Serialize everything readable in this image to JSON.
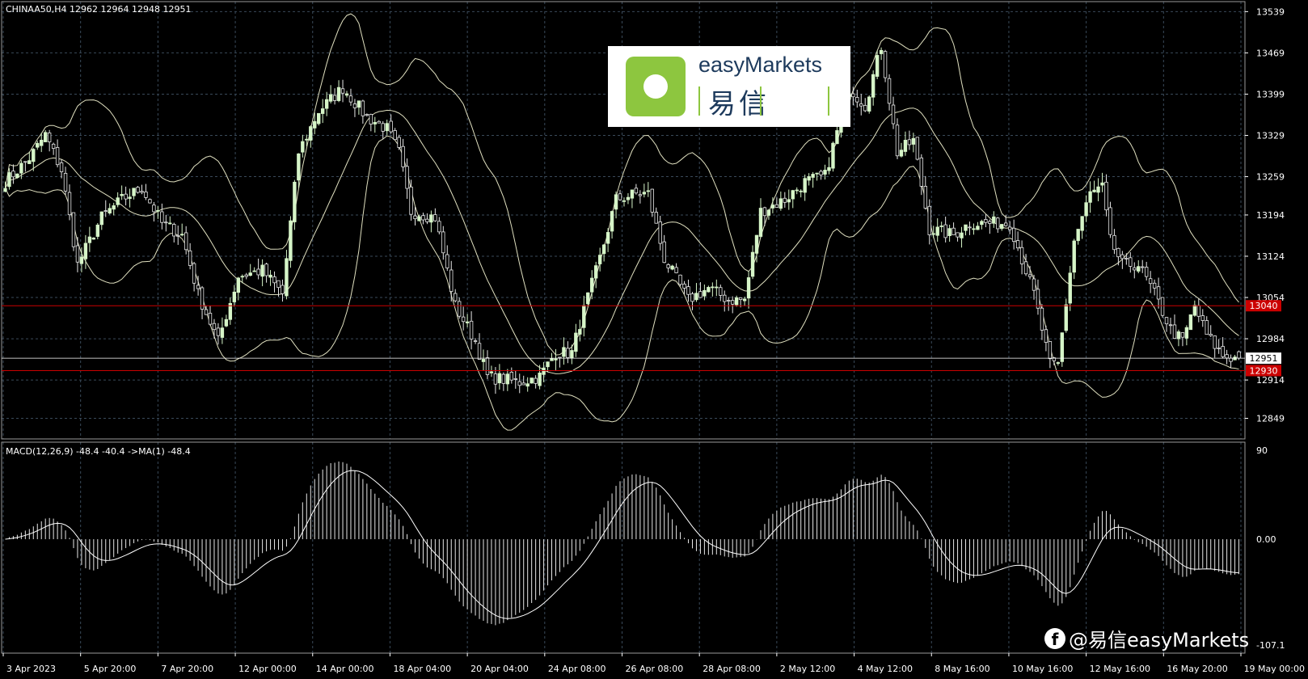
{
  "chart_data": [
    {
      "type": "candlestick",
      "header": "CHINAA50,H4  12962 12964 12948 12951",
      "symbol": "CHINAA50",
      "timeframe": "H4",
      "ohlc_current": {
        "open": 12962,
        "high": 12964,
        "low": 12948,
        "close": 12951
      },
      "price_axis": {
        "ticks": [
          "13539",
          "13469",
          "13399",
          "13329",
          "13259",
          "13194",
          "13124",
          "13054",
          "12984",
          "12914",
          "12849"
        ],
        "range": [
          12825,
          13545
        ]
      },
      "time_labels": [
        "3 Apr 2023",
        "5 Apr 20:00",
        "7 Apr 20:00",
        "12 Apr 00:00",
        "14 Apr 00:00",
        "18 Apr 04:00",
        "20 Apr 04:00",
        "24 Apr 08:00",
        "26 Apr 08:00",
        "28 Apr 08:00",
        "2 May 12:00",
        "4 May 12:00",
        "8 May 16:00",
        "10 May 16:00",
        "12 May 16:00",
        "16 May 20:00",
        "19 May 00:00"
      ],
      "price_tags": [
        {
          "value": 13040,
          "label": "13040",
          "color": "#cc0000"
        },
        {
          "value": 12951,
          "label": "12951",
          "color": "#ffffff"
        },
        {
          "value": 12930,
          "label": "12930",
          "color": "#cc0000"
        }
      ],
      "horizontal_lines": [
        {
          "value": 13040,
          "color": "#cc0000"
        },
        {
          "value": 12930,
          "color": "#cc0000"
        }
      ],
      "close_anchors": [
        [
          0,
          13250
        ],
        [
          6,
          13290
        ],
        [
          10,
          13330
        ],
        [
          14,
          13270
        ],
        [
          18,
          13110
        ],
        [
          24,
          13190
        ],
        [
          29,
          13220
        ],
        [
          34,
          13240
        ],
        [
          39,
          13180
        ],
        [
          44,
          13160
        ],
        [
          48,
          13060
        ],
        [
          53,
          12980
        ],
        [
          58,
          13090
        ],
        [
          64,
          13100
        ],
        [
          69,
          13060
        ],
        [
          73,
          13300
        ],
        [
          78,
          13370
        ],
        [
          84,
          13410
        ],
        [
          90,
          13360
        ],
        [
          95,
          13340
        ],
        [
          98,
          13300
        ],
        [
          101,
          13200
        ],
        [
          107,
          13190
        ],
        [
          112,
          13040
        ],
        [
          117,
          12980
        ],
        [
          120,
          12920
        ],
        [
          128,
          12910
        ],
        [
          133,
          12920
        ],
        [
          137,
          12960
        ],
        [
          141,
          12960
        ],
        [
          143,
          13010
        ],
        [
          148,
          13120
        ],
        [
          152,
          13220
        ],
        [
          157,
          13230
        ],
        [
          160,
          13230
        ],
        [
          164,
          13120
        ],
        [
          170,
          13050
        ],
        [
          175,
          13070
        ],
        [
          180,
          13050
        ],
        [
          184,
          13050
        ],
        [
          188,
          13200
        ],
        [
          194,
          13220
        ],
        [
          199,
          13250
        ],
        [
          204,
          13260
        ],
        [
          210,
          13410
        ],
        [
          214,
          13380
        ],
        [
          218,
          13480
        ],
        [
          222,
          13300
        ],
        [
          226,
          13320
        ],
        [
          230,
          13170
        ],
        [
          236,
          13160
        ],
        [
          240,
          13180
        ],
        [
          245,
          13180
        ],
        [
          250,
          13180
        ],
        [
          256,
          13060
        ],
        [
          260,
          12940
        ],
        [
          262,
          12940
        ],
        [
          266,
          13150
        ],
        [
          270,
          13230
        ],
        [
          273,
          13240
        ],
        [
          275,
          13150
        ],
        [
          278,
          13110
        ],
        [
          282,
          13110
        ],
        [
          286,
          13060
        ],
        [
          290,
          13000
        ],
        [
          293,
          12980
        ],
        [
          296,
          13040
        ],
        [
          299,
          12990
        ],
        [
          303,
          12955
        ],
        [
          306,
          12951
        ]
      ],
      "bollinger": {
        "period": 20,
        "deviations": 2
      },
      "colors": {
        "bull": "#d6f5c8",
        "bear": "#e8e8e8",
        "bands": "#e0e0c0",
        "grid": "#3a4a5a"
      }
    },
    {
      "type": "bar",
      "label": "MACD(12,26,9) -48.4 -40.4  ->MA(1) -48.4",
      "indicator": "MACD",
      "parameters": {
        "fast": 12,
        "slow": 26,
        "signal": 9
      },
      "values": {
        "macd": -48.4,
        "signal": -40.4,
        "ma1": -48.4
      },
      "axis_ticks": [
        "90",
        "0.00",
        "-107.1"
      ],
      "range": [
        -107.1,
        90
      ],
      "series": [
        {
          "name": "MACD",
          "style": "histogram"
        },
        {
          "name": "Signal",
          "style": "line"
        }
      ]
    }
  ],
  "branding": {
    "logo_text": "easyMarkets",
    "logo_cn": "易信",
    "watermark": "@易信easyMarkets",
    "facebook_glyph": "f"
  }
}
